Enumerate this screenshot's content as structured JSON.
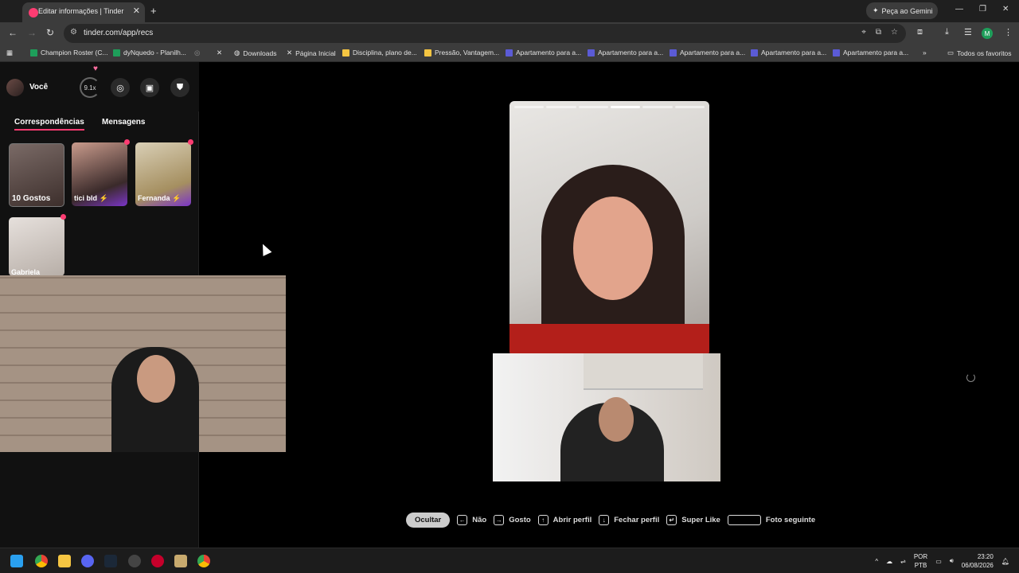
{
  "browser": {
    "tab_title": "Editar informações | Tinder",
    "gemini_label": "Peça ao Gemini",
    "url": "tinder.com/app/recs",
    "profile_initial": "M"
  },
  "bookmarks": {
    "items": [
      {
        "label": "Champion Roster (C...",
        "icon_color": "#1e9e5a"
      },
      {
        "label": "dyNquedo - Planilh...",
        "icon_color": "#1e9e5a"
      },
      {
        "label": "Downloads",
        "icon_color": "#bbbbbb"
      },
      {
        "label": "Página Inicial",
        "icon_color": "#ffffff"
      },
      {
        "label": "Disciplina, plano de...",
        "icon_color": "#f5c542"
      },
      {
        "label": "Pressão, Vantagem...",
        "icon_color": "#f5c542"
      },
      {
        "label": "Apartamento para a...",
        "icon_color": "#5b5bd6"
      },
      {
        "label": "Apartamento para a...",
        "icon_color": "#5b5bd6"
      },
      {
        "label": "Apartamento para a...",
        "icon_color": "#5b5bd6"
      },
      {
        "label": "Apartamento para a...",
        "icon_color": "#5b5bd6"
      },
      {
        "label": "Apartamento para a...",
        "icon_color": "#5b5bd6"
      }
    ],
    "all_bookmarks": "Todos os favoritos"
  },
  "sidebar": {
    "you_label": "Você",
    "boost_value": "9.1x",
    "tabs": {
      "matches": "Correspondências",
      "messages": "Mensagens"
    },
    "matches": [
      {
        "name": "10 Gostos"
      },
      {
        "name": "tici bld ⚡"
      },
      {
        "name": "Fernanda ⚡"
      },
      {
        "name": "Gabriela"
      }
    ]
  },
  "card": {
    "photo_count": 6,
    "active_photo_index": 3
  },
  "hints": {
    "hide_label": "Ocultar",
    "items": [
      {
        "key": "←",
        "label": "Não"
      },
      {
        "key": "→",
        "label": "Gosto"
      },
      {
        "key": "↑",
        "label": "Abrir perfil"
      },
      {
        "key": "↓",
        "label": "Fechar perfil"
      },
      {
        "key": "↵",
        "label": "Super Like"
      },
      {
        "key": "",
        "label": "Foto seguinte"
      }
    ]
  },
  "taskbar": {
    "lang_top": "POR",
    "lang_bottom": "PTB",
    "time": "23:20",
    "date": "06/08/2026"
  }
}
